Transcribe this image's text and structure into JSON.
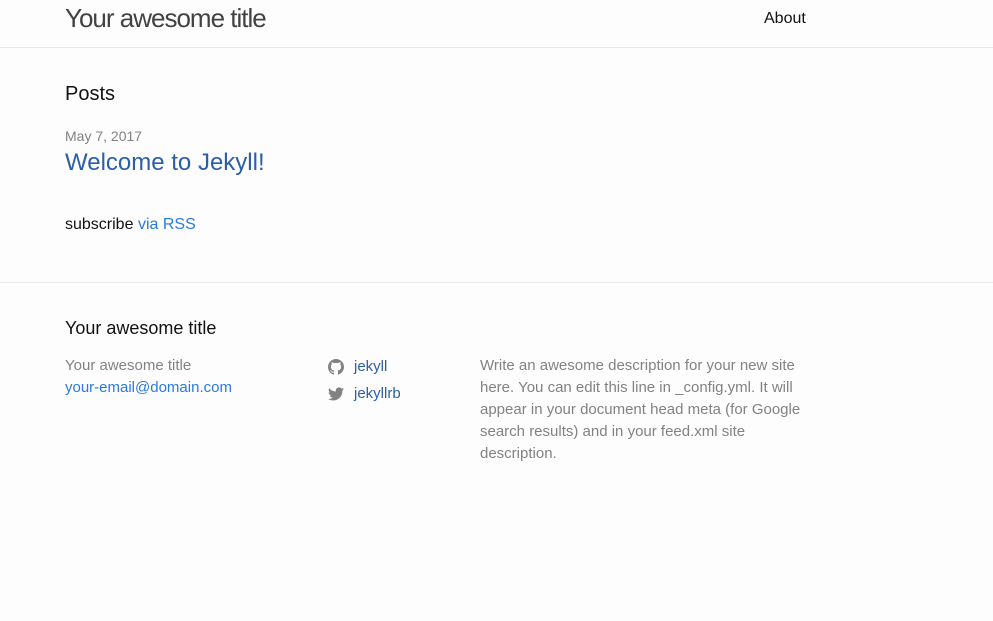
{
  "header": {
    "site_title": "Your awesome title",
    "nav": [
      {
        "label": "About"
      }
    ]
  },
  "main": {
    "posts_heading": "Posts",
    "posts": [
      {
        "date": "May 7, 2017",
        "title": "Welcome to Jekyll!"
      }
    ],
    "rss": {
      "prefix": "subscribe",
      "link_label": "via RSS"
    }
  },
  "footer": {
    "heading": "Your awesome title",
    "contact": {
      "name": "Your awesome title",
      "email": "your-email@domain.com"
    },
    "social": [
      {
        "icon": "github-icon",
        "label": "jekyll"
      },
      {
        "icon": "twitter-icon",
        "label": "jekyllrb"
      }
    ],
    "description": "Write an awesome description for your new site here. You can edit this line in _config.yml. It will appear in your document head meta (for Google search results) and in your feed.xml site description."
  },
  "colors": {
    "link": "#2a7ae2",
    "meta_text": "#828282",
    "border": "#e8e8e8",
    "background": "#fdfdfd"
  }
}
